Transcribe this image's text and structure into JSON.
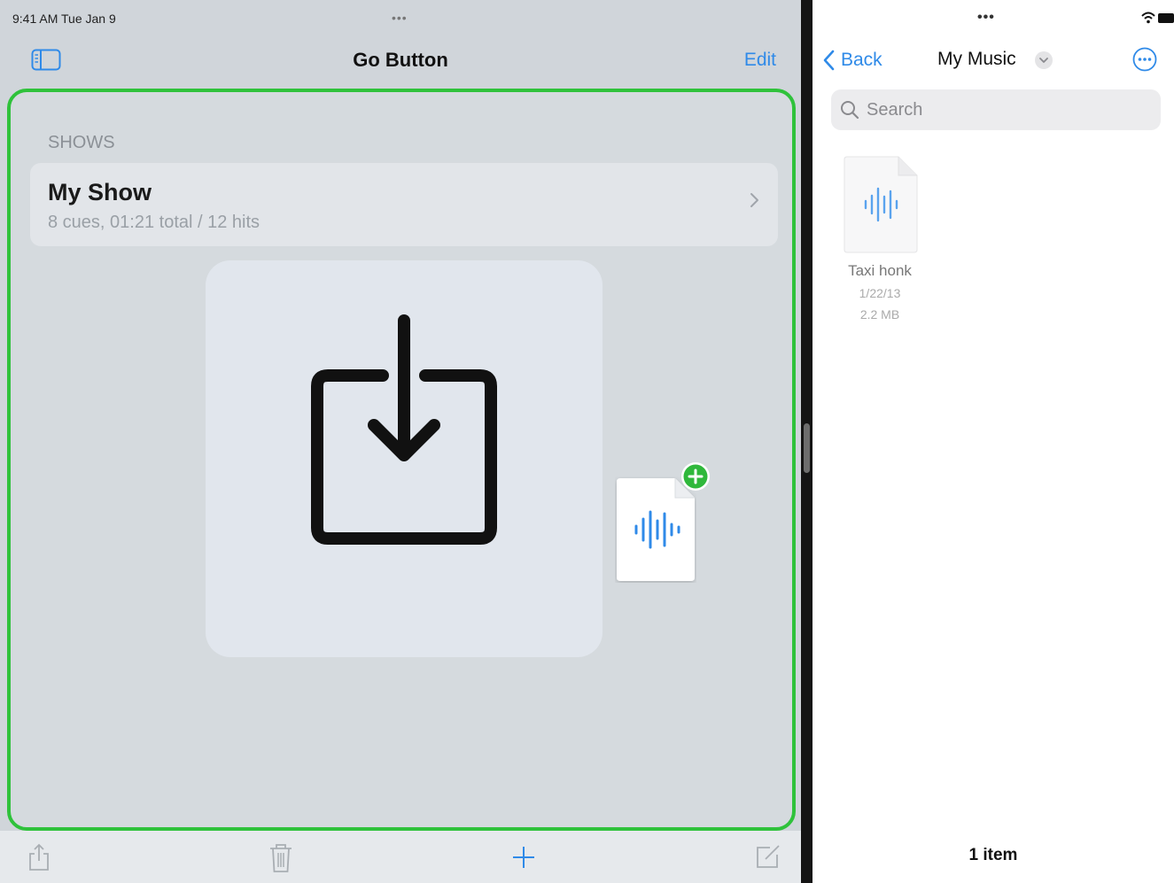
{
  "left": {
    "status_time": "9:41 AM   Tue Jan 9",
    "dots": "•••",
    "title": "Go Button",
    "edit_label": "Edit",
    "section_header": "SHOWS",
    "show": {
      "title": "My Show",
      "subtitle": "8 cues, 01:21 total   / 12 hits"
    },
    "toolbar": [
      "share-icon",
      "trash-icon",
      "plus-icon",
      "compose-icon"
    ],
    "colors": {
      "accent": "#2f8ae8",
      "drop_border": "#2fc23b"
    }
  },
  "right": {
    "dots": "•••",
    "back_label": "Back",
    "title": "My Music",
    "search_placeholder": "Search",
    "files": [
      {
        "name": "Taxi honk",
        "date": "1/22/13",
        "size": "2.2 MB"
      }
    ],
    "item_count": "1 item"
  }
}
